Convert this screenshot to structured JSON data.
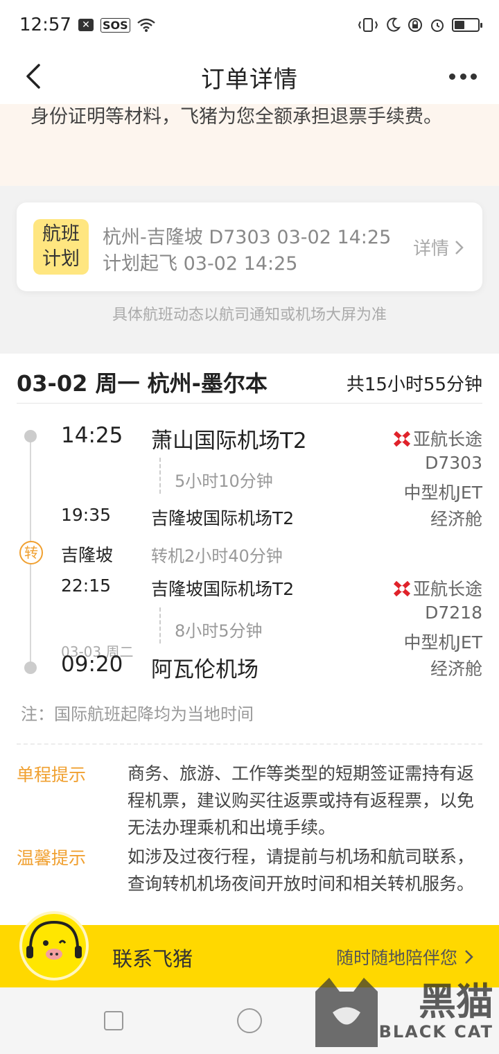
{
  "status_bar": {
    "time": "12:57",
    "sos": "SOS",
    "battery_level": 0.45
  },
  "nav": {
    "title": "订单详情"
  },
  "notice": {
    "text": "航班计划变动，如需退票请联系客服，飞猪平台提供身份证明等材料，飞猪为您全额承担退票手续费。"
  },
  "flight_plan": {
    "badge_line1": "航班",
    "badge_line2": "计划",
    "line1": "杭州-吉隆坡 D7303 03-02 14:25",
    "line2": "计划起飞 03-02 14:25",
    "detail": "详情",
    "note": "具体航班动态以航司通知或机场大屏为准"
  },
  "trip": {
    "title": "03-02 周一 杭州-墨尔本",
    "total": "共15小时55分钟",
    "segments": [
      {
        "dep_time": "14:25",
        "dep_airport": "萧山国际机场T2",
        "duration": "5小时10分钟",
        "arr_time": "19:35",
        "arr_airport": "吉隆坡国际机场T2",
        "airline": "亚航长途",
        "flight_no": "D7303",
        "aircraft": "中型机JET",
        "cabin": "经济舱"
      },
      {
        "dep_time": "22:15",
        "dep_airport": "吉隆坡国际机场T2",
        "duration": "8小时5分钟",
        "arr_date": "03-03 周二",
        "arr_time": "09:20",
        "arr_airport": "阿瓦伦机场",
        "airline": "亚航长途",
        "flight_no": "D7218",
        "aircraft": "中型机JET",
        "cabin": "经济舱"
      }
    ],
    "transfer": {
      "mark": "转",
      "city": "吉隆坡",
      "text": "转机2小时40分钟"
    },
    "local_note": "注：国际航班起降均为当地时间"
  },
  "tips": [
    {
      "label": "单程提示",
      "text": "商务、旅游、工作等类型的短期签证需持有返程机票，建议购买往返票或持有返程票，以免无法办理乘机和出境手续。"
    },
    {
      "label": "温馨提示",
      "text": "如涉及过夜行程，请提前与机场和航司联系，查询转机机场夜间开放时间和相关转机服务。"
    }
  ],
  "contact": {
    "label": "联系飞猪",
    "sub": "随时随地陪伴您"
  },
  "watermark": {
    "cn": "黑猫",
    "en": "BLACK CAT"
  },
  "colors": {
    "accent": "#f0a030",
    "contact_bg": "#ffd800",
    "badge_bg": "#ffe680",
    "notice_bg": "#fdf5ee",
    "airline_red": "#e0222a"
  },
  "icons": [
    "back-arrow-icon",
    "more-dots-icon",
    "chevron-right-icon",
    "airasia-logo-icon",
    "mascot-icon",
    "wifi-icon",
    "alarm-icon"
  ]
}
